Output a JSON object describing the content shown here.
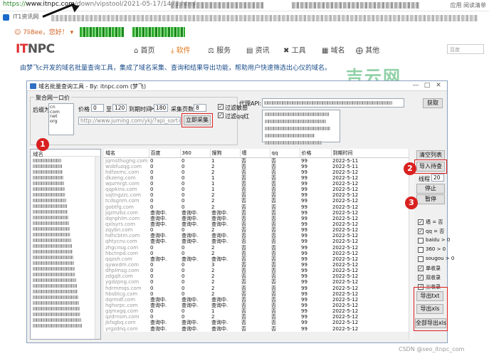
{
  "browser": {
    "url_proto": "https://",
    "url_host": "www.itnpc.com",
    "url_path": "/down/vipstool/2021-05-17/1473.html",
    "bookmark_tab": "IT1资讯网",
    "right_labels": [
      "应用",
      "阅读清单"
    ]
  },
  "site": {
    "greeting": "7li8ee，您好！",
    "logo_it": "IT",
    "logo_npc": "NPC",
    "nav": [
      {
        "icon": "home-icon",
        "label": "首页"
      },
      {
        "icon": "download-icon",
        "label": "软件"
      },
      {
        "icon": "handshake-icon",
        "label": "服务"
      },
      {
        "icon": "news-icon",
        "label": "资讯"
      },
      {
        "icon": "tools-icon",
        "label": "工具"
      },
      {
        "icon": "domain-icon",
        "label": "域名"
      },
      {
        "icon": "more-icon",
        "label": "其他"
      }
    ],
    "search_placeholder": "百度",
    "intro": "由梦飞c开发的域名批量查询工具，集成了域名采集、查询和结果导出功能，帮助用户快速筛选出心仪的域名。",
    "watermark": "吉云网",
    "footer": "CSDN @seo_itnpc_com"
  },
  "app": {
    "title": "域名批量查询工具 - By: itnpc.com (梦飞)",
    "group_title": "聚合网一口价",
    "suffix_label": "后缀为",
    "suffixes": [
      "cn",
      "com",
      "net",
      "org"
    ],
    "price_label": "价格",
    "price_from": "0",
    "to_label": "至",
    "price_to": "120",
    "expire_label": "到期时间",
    "expire_op": ">",
    "expire_value": "180",
    "pages_label": "采集页数",
    "pages_value": "8",
    "filter_sensitive": "过滤敏感",
    "filter_qq": "过滤qq红",
    "collect_btn": "立即采集",
    "url_value": "http://www.juming.com/ykj/?api_sort=0&ymlx=0&...",
    "proxy_label": "代理API:",
    "fetch_btn": "获取",
    "left_header": "域名",
    "columns": [
      "域名",
      "百度",
      "360",
      "搜狗",
      "墙",
      "qq",
      "价格",
      "到期时间"
    ],
    "rows": [
      [
        "jqrnsthugng.com",
        "0",
        "0",
        "1",
        "否",
        "否",
        "99",
        "2022-5-11"
      ],
      [
        "wobfuzqg.com",
        "0",
        "0",
        "2",
        "否",
        "否",
        "99",
        "2022-5-11"
      ],
      [
        "hdfzemc.com",
        "0",
        "0",
        "2",
        "否",
        "否",
        "99",
        "2022-5-12"
      ],
      [
        "dkzeng.com",
        "0",
        "0",
        "1",
        "否",
        "否",
        "99",
        "2022-5-12"
      ],
      [
        "wpzmrgt.com",
        "0",
        "0",
        "1",
        "否",
        "否",
        "99",
        "2022-5-12"
      ],
      [
        "qqpkins.com",
        "0",
        "0",
        "1",
        "否",
        "否",
        "99",
        "2022-5-12"
      ],
      [
        "sajtngzzc.com",
        "0",
        "0",
        "2",
        "否",
        "否",
        "99",
        "2022-5-12"
      ],
      [
        "tcdsgnm.com",
        "0",
        "0",
        "2",
        "否",
        "否",
        "99",
        "2022-5-12"
      ],
      [
        "gobtfg.com",
        "0",
        "0",
        "2",
        "否",
        "否",
        "99",
        "2022-5-12"
      ],
      [
        "jqzmzbz.com",
        "查询中.",
        "查询中.",
        "查询中.",
        "否",
        "否",
        "99",
        "2022-5-12"
      ],
      [
        "dqnphlm.com",
        "查询中.",
        "查询中.",
        "查询中.",
        "否",
        "否",
        "99",
        "2022-5-12"
      ],
      [
        "qxlsyrs.com",
        "查询中.",
        "查询中.",
        "查询中.",
        "否",
        "否",
        "99",
        "2022-5-12"
      ],
      [
        "zqybn.com",
        "0",
        "0",
        "2",
        "否",
        "否",
        "99",
        "2022-5-12"
      ],
      [
        "hdhcbtm.com",
        "查询中.",
        "查询中.",
        "查询中.",
        "否",
        "否",
        "99",
        "2022-5-12"
      ],
      [
        "qhtycnv.com",
        "查询中.",
        "查询中.",
        "查询中.",
        "否",
        "否",
        "99",
        "2022-5-12"
      ],
      [
        "zhgcnsg.com",
        "0",
        "0",
        "2",
        "否",
        "否",
        "99",
        "2022-5-12"
      ],
      [
        "hbctnpd.com",
        "0",
        "0",
        "2",
        "否",
        "否",
        "99",
        "2022-5-12"
      ],
      [
        "qqzsh.com",
        "查询中.",
        "查询中.",
        "查询中.",
        "否",
        "否",
        "99",
        "2022-5-12"
      ],
      [
        "qywxdm.com",
        "0",
        "0",
        "3",
        "否",
        "否",
        "99",
        "2022-5-12"
      ],
      [
        "dhplmsg.com",
        "0",
        "0",
        "2",
        "否",
        "否",
        "99",
        "2022-5-12"
      ],
      [
        "zdgqlt.com",
        "0",
        "0",
        "2",
        "否",
        "否",
        "99",
        "2022-5-12"
      ],
      [
        "ygdzpng.com",
        "0",
        "0",
        "2",
        "否",
        "否",
        "99",
        "2022-5-12"
      ],
      [
        "hdrmmqs.com",
        "0",
        "0",
        "2",
        "否",
        "否",
        "99",
        "2022-5-12"
      ],
      [
        "hbsbtcg.com",
        "0",
        "0",
        "2",
        "否",
        "否",
        "99",
        "2022-5-12"
      ],
      [
        "dqrmdf.com",
        "查询中.",
        "查询中.",
        "查询中.",
        "否",
        "否",
        "99",
        "2022-5-12"
      ],
      [
        "hghsrpc.com",
        "查询中.",
        "查询中.",
        "查询中.",
        "否",
        "否",
        "99",
        "2022-5-12"
      ],
      [
        "gqmxgq.com",
        "0",
        "0",
        "1",
        "否",
        "否",
        "99",
        "2022-5-12"
      ],
      [
        "qzdrnsm.com",
        "0",
        "0",
        "2",
        "否",
        "否",
        "99",
        "2022-5-12"
      ],
      [
        "jkfsgbq.com",
        "查询中.",
        "查询中.",
        "查询中.",
        "否",
        "否",
        "99",
        "2022-5-12"
      ],
      [
        "yrgzdnq.com",
        "查询中.",
        "查询中.",
        "查询中.",
        "否",
        "否",
        "99",
        "2022-5-12"
      ]
    ],
    "btn_clear": "清空列表",
    "btn_import": "导入待查",
    "thread_label": "线程",
    "thread_value": "20",
    "btn_stop": "停止",
    "btn_pause": "暂停",
    "filters": [
      {
        "label": "墙 = 否",
        "checked": true
      },
      {
        "label": "qq = 否",
        "checked": true
      },
      {
        "label": "baidu > 0",
        "checked": false
      },
      {
        "label": "360 > 0",
        "checked": false
      },
      {
        "label": "sougou > 0",
        "checked": false
      },
      {
        "label": "单收录",
        "checked": true
      },
      {
        "label": "双收录",
        "checked": true
      },
      {
        "label": "三收录",
        "checked": true
      }
    ],
    "btn_export_txt": "导出txt",
    "btn_export_xls": "导出xls",
    "btn_export_all": "全部导出xls",
    "badges": [
      "1",
      "2",
      "3"
    ]
  }
}
